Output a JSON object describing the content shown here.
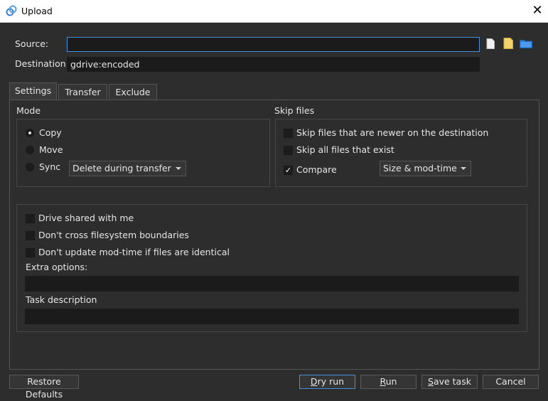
{
  "window": {
    "title": "Upload",
    "close_glyph": "✕"
  },
  "form": {
    "source_label": "Source:",
    "source_value": "",
    "destination_label": "Destination:",
    "destination_value": "gdrive:encoded"
  },
  "tabs": [
    {
      "label": "Settings",
      "active": true
    },
    {
      "label": "Transfer",
      "active": false
    },
    {
      "label": "Exclude",
      "active": false
    }
  ],
  "mode": {
    "heading": "Mode",
    "options": [
      {
        "label": "Copy",
        "selected": true
      },
      {
        "label": "Move",
        "selected": false
      },
      {
        "label": "Sync",
        "selected": false
      }
    ],
    "sync_dropdown": "Delete during transfer"
  },
  "skip": {
    "heading": "Skip files",
    "newer": {
      "label": "Skip files that are newer on the destination",
      "checked": false
    },
    "exist": {
      "label": "Skip all files that exist",
      "checked": false
    },
    "compare": {
      "label": "Compare",
      "checked": true
    },
    "compare_dropdown": "Size & mod-time"
  },
  "options": {
    "shared": {
      "label": "Drive shared with me",
      "checked": false
    },
    "no_cross": {
      "label": "Don't cross filesystem boundaries",
      "checked": false
    },
    "no_update": {
      "label": "Don't update mod-time if files are identical",
      "checked": false
    },
    "extra_label": "Extra options:",
    "extra_value": "",
    "task_label": "Task description",
    "task_value": ""
  },
  "buttons": {
    "restore": "Restore Defaults",
    "dry_run": {
      "u": "D",
      "rest": "ry run"
    },
    "run": {
      "u": "R",
      "rest": "un"
    },
    "save": {
      "u": "S",
      "rest": "ave task"
    },
    "cancel": "Cancel"
  },
  "colors": {
    "accent": "#4a90d9",
    "background": "#2d2d2d",
    "field": "#1b1b1b"
  },
  "icons": [
    "app-logo-icon",
    "close-icon",
    "file-icon",
    "note-icon",
    "folder-icon"
  ]
}
